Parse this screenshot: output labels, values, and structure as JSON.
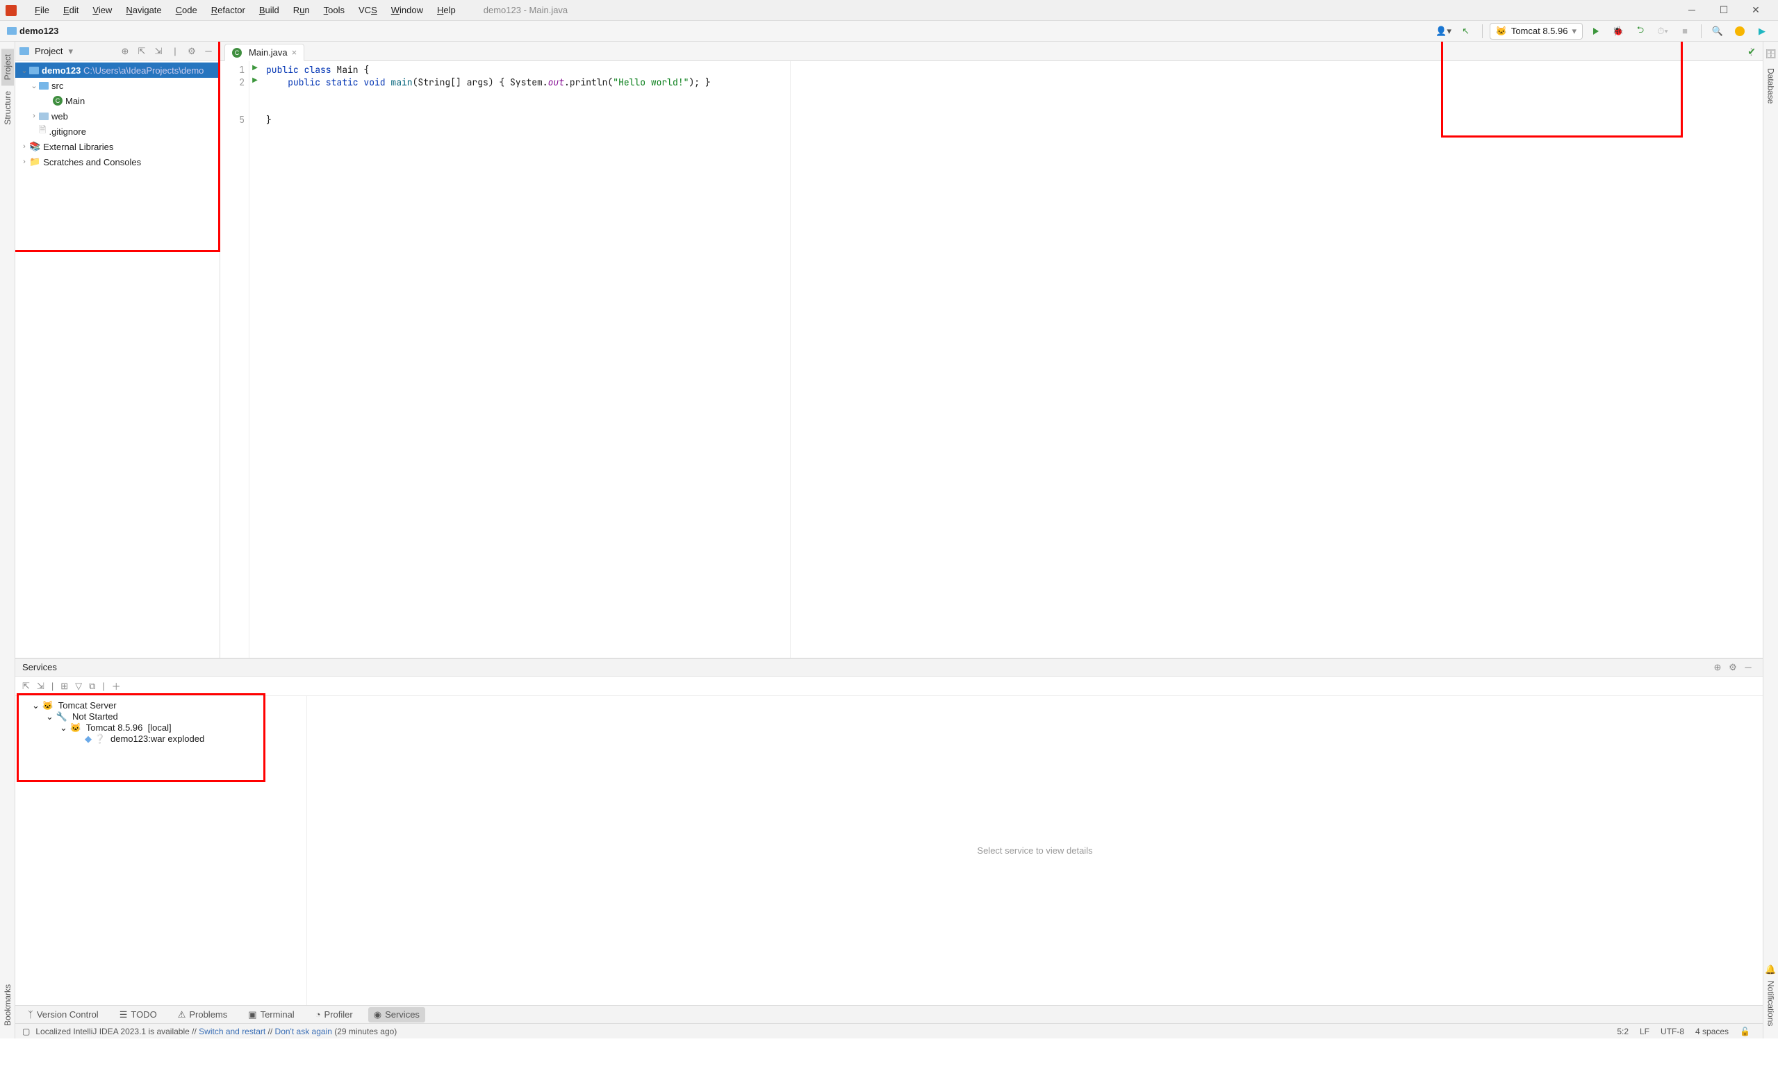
{
  "menu": {
    "items": [
      "File",
      "Edit",
      "View",
      "Navigate",
      "Code",
      "Refactor",
      "Build",
      "Run",
      "Tools",
      "VCS",
      "Window",
      "Help"
    ],
    "title": "demo123 - Main.java"
  },
  "breadcrumb": {
    "project": "demo123"
  },
  "run_config": {
    "label": "Tomcat 8.5.96"
  },
  "project_panel": {
    "title": "Project",
    "root": "demo123",
    "root_path": "C:\\Users\\a\\IdeaProjects\\demo",
    "src": "src",
    "main_class": "Main",
    "web": "web",
    "gitignore": ".gitignore",
    "ext_lib": "External Libraries",
    "scratches": "Scratches and Consoles"
  },
  "editor": {
    "tab": "Main.java",
    "lines": [
      "1",
      "2",
      "",
      "",
      "5"
    ],
    "code": {
      "l1a": "public class",
      "l1b": " Main {",
      "l2a": "    public static void ",
      "l2b": "main",
      "l2c": "(String[] args) { System.",
      "l2d": "out",
      "l2e": ".println(",
      "l2f": "\"Hello world!\"",
      "l2g": "); }",
      "l3": "}"
    }
  },
  "services": {
    "title": "Services",
    "root": "Tomcat Server",
    "status": "Not Started",
    "instance": "Tomcat 8.5.96",
    "instance_tag": "[local]",
    "artifact": "demo123:war exploded",
    "placeholder": "Select service to view details"
  },
  "left_tabs": {
    "project": "Project",
    "structure": "Structure",
    "bookmarks": "Bookmarks"
  },
  "right_tabs": {
    "database": "Database",
    "notifications": "Notifications"
  },
  "bottom_tabs": {
    "vcs": "Version Control",
    "todo": "TODO",
    "problems": "Problems",
    "terminal": "Terminal",
    "profiler": "Profiler",
    "services": "Services"
  },
  "status": {
    "msg1": "Localized IntelliJ IDEA 2023.1 is available",
    "msg2": "Switch and restart",
    "msg3": "Don't ask again",
    "msg4": "(29 minutes ago)",
    "pos": "5:2",
    "le": "LF",
    "enc": "UTF-8",
    "indent": "4 spaces"
  }
}
